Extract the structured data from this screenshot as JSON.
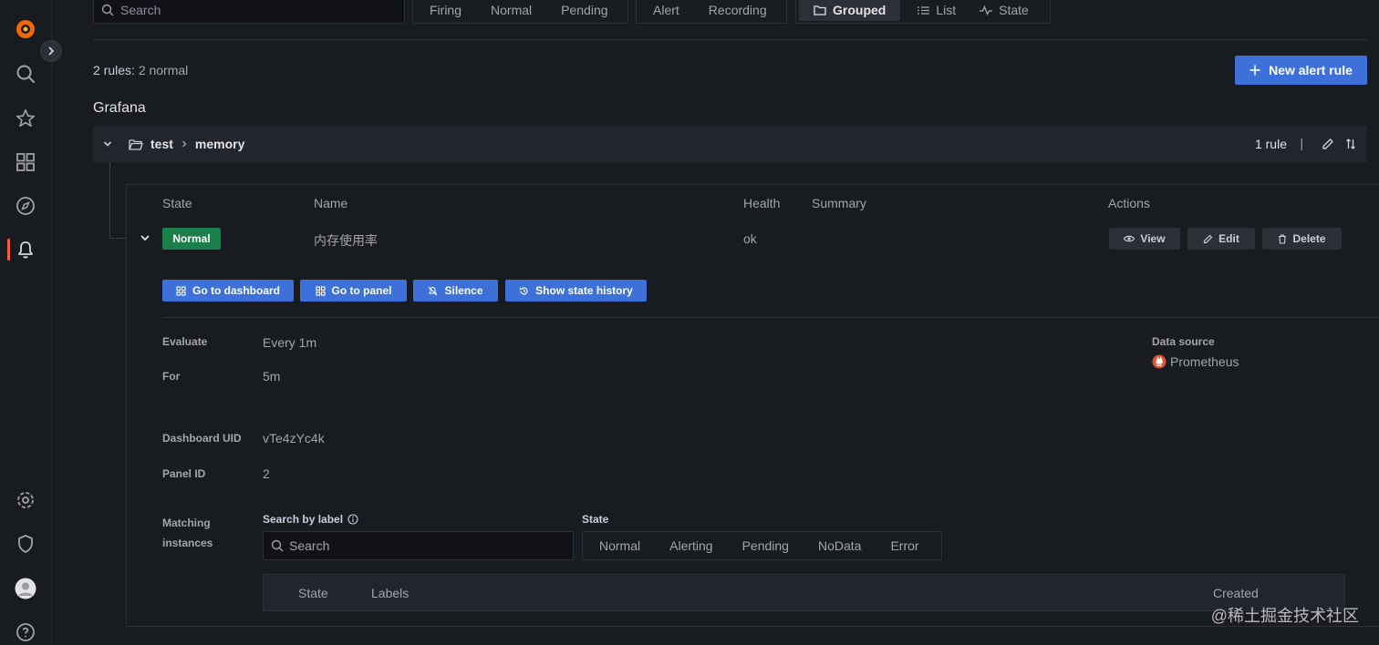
{
  "sidebar": {
    "items": [
      "grafana-logo",
      "search",
      "starred",
      "dashboards",
      "explore",
      "alerting",
      "configuration",
      "server-admin",
      "profile",
      "help"
    ]
  },
  "toolbar": {
    "search_placeholder": "Search",
    "state_filters": [
      "Firing",
      "Normal",
      "Pending"
    ],
    "type_filters": [
      "Alert",
      "Recording"
    ],
    "views": [
      "Grouped",
      "List",
      "State"
    ],
    "active_view": "Grouped"
  },
  "summary": {
    "rules_label": "2 rules:",
    "rules_detail": "2 normal"
  },
  "new_rule_button": "New alert rule",
  "namespace": {
    "title": "Grafana",
    "folder": "test",
    "group": "memory",
    "rule_count": "1 rule",
    "pipe": "|"
  },
  "table": {
    "headers": {
      "state": "State",
      "name": "Name",
      "health": "Health",
      "summary": "Summary",
      "actions": "Actions"
    },
    "row": {
      "state": "Normal",
      "name": "内存使用率",
      "health": "ok",
      "summary": ""
    },
    "row_actions": [
      "View",
      "Edit",
      "Delete"
    ]
  },
  "rule_buttons": [
    "Go to dashboard",
    "Go to panel",
    "Silence",
    "Show state history"
  ],
  "details": {
    "evaluate_label": "Evaluate",
    "evaluate_value": "Every 1m",
    "for_label": "For",
    "for_value": "5m",
    "dashboard_uid_label": "Dashboard UID",
    "dashboard_uid_value": "vTe4zYc4k",
    "panel_id_label": "Panel ID",
    "panel_id_value": "2",
    "datasource_label": "Data source",
    "datasource_value": "Prometheus"
  },
  "instances": {
    "label_line1": "Matching",
    "label_line2": "instances",
    "search_label": "Search by label",
    "search_placeholder": "Search",
    "state_label": "State",
    "state_filters": [
      "Normal",
      "Alerting",
      "Pending",
      "NoData",
      "Error"
    ],
    "columns": {
      "state": "State",
      "labels": "Labels",
      "created": "Created"
    }
  },
  "watermark": "@稀土掘金技术社区",
  "colors": {
    "primary": "#3d71d9",
    "normal_badge": "#1a7f4b",
    "accent": "#f55f3e"
  }
}
